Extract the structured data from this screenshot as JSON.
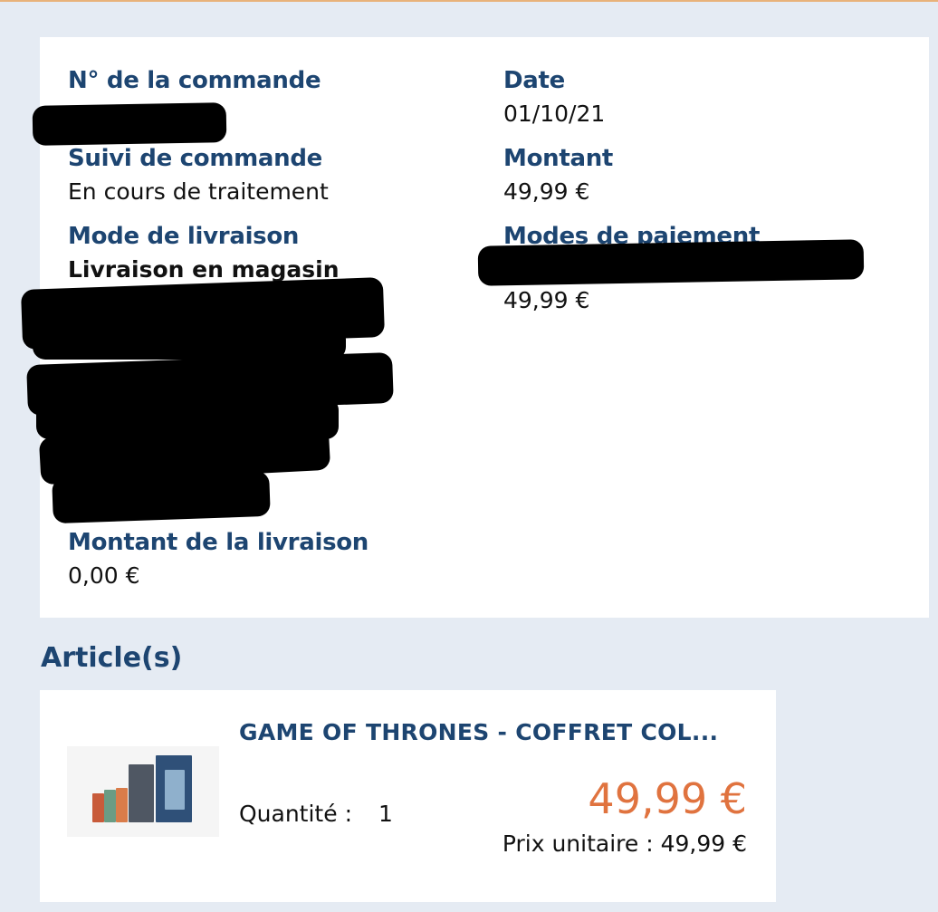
{
  "order": {
    "number_label": "N° de la commande",
    "date_label": "Date",
    "date_value": "01/10/21",
    "tracking_label": "Suivi de commande",
    "tracking_value": "En cours de traitement",
    "amount_label": "Montant",
    "amount_value": "49,99 €",
    "delivery_mode_label": "Mode de livraison",
    "delivery_mode_value": "Livraison en magasin",
    "payment_modes_label": "Modes de paiement",
    "payment_amount": "49,99 €",
    "delivery_amount_label": "Montant de la livraison",
    "delivery_amount_value": "0,00 €"
  },
  "articles": {
    "title": "Article(s)",
    "items": [
      {
        "name": "GAME OF THRONES - COFFRET COL...",
        "quantity_label": "Quantité :",
        "quantity": "1",
        "price": "49,99 €",
        "unit_price_text": "Prix unitaire : 49,99 €"
      }
    ]
  },
  "colors": {
    "background": "#e5ebf3",
    "label_blue": "#1d4571",
    "price_orange": "#e0733f",
    "top_border": "#e8b27a"
  },
  "icons": {
    "product_thumbnail": "box-set-image"
  }
}
